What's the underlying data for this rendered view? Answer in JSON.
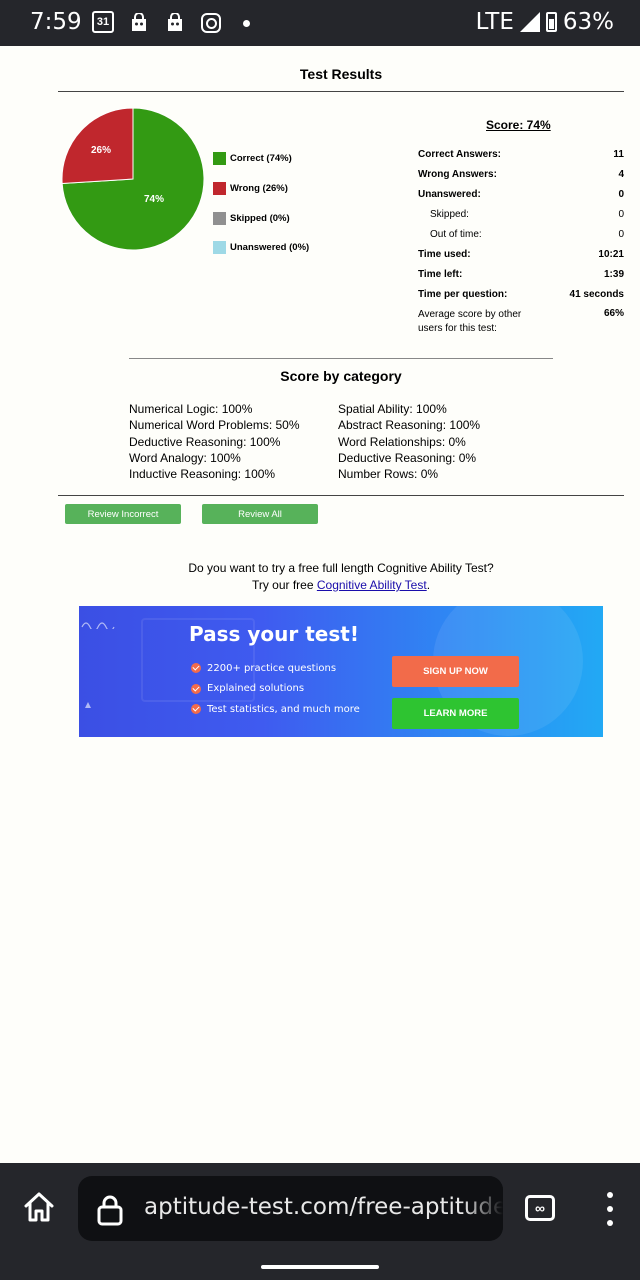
{
  "status_bar": {
    "time": "7:59",
    "calendar_date": "31",
    "network": "LTE",
    "battery": "63%"
  },
  "results": {
    "title": "Test Results",
    "score_label": "Score: 74%",
    "pie": {
      "correct_label": "74%",
      "wrong_label": "26%",
      "correct_fraction": 0.74,
      "wrong_fraction": 0.26
    },
    "legend": [
      {
        "label": "Correct (74%)",
        "color": "#339a13"
      },
      {
        "label": "Wrong (26%)",
        "color": "#c0272d"
      },
      {
        "label": "Skipped (0%)",
        "color": "#909090"
      },
      {
        "label": "Unanswered (0%)",
        "color": "#9ed9e6"
      }
    ],
    "stats": [
      {
        "label": "Correct Answers:",
        "value": "11"
      },
      {
        "label": "Wrong Answers:",
        "value": "4"
      },
      {
        "label": "Unanswered:",
        "value": "0"
      },
      {
        "label": "Skipped:",
        "value": "0"
      },
      {
        "label": "Out of time:",
        "value": "0"
      },
      {
        "label": "Time used:",
        "value": "10:21"
      },
      {
        "label": "Time left:",
        "value": "1:39"
      },
      {
        "label": "Time per question:",
        "value": "41 seconds"
      },
      {
        "label": "Average score by other users for this test:",
        "value": "66%"
      }
    ]
  },
  "categories": {
    "title": "Score by category",
    "left": [
      "Numerical Logic: 100%",
      "Numerical Word Problems: 50%",
      "Deductive Reasoning: 100%",
      "Word Analogy: 100%",
      "Inductive Reasoning: 100%"
    ],
    "right": [
      "Spatial Ability: 100%",
      "Abstract Reasoning: 100%",
      "Word Relationships: 0%",
      "Deductive Reasoning: 0%",
      "Number Rows: 0%"
    ]
  },
  "buttons": {
    "review_incorrect": "Review Incorrect",
    "review_all": "Review All"
  },
  "promo": {
    "line1": "Do you want to try a free full length Cognitive Ability Test?",
    "line2_prefix": "Try our free ",
    "line2_link": "Cognitive Ability Test",
    "line2_suffix": "."
  },
  "banner": {
    "title": "Pass your test!",
    "bullets": [
      "2200+ practice questions",
      "Explained solutions",
      "Test statistics, and much more"
    ],
    "signup_label": "SIGN UP NOW",
    "learn_label": "LEARN MORE"
  },
  "browser": {
    "url": "aptitude-test.com/free-aptitude-test"
  }
}
